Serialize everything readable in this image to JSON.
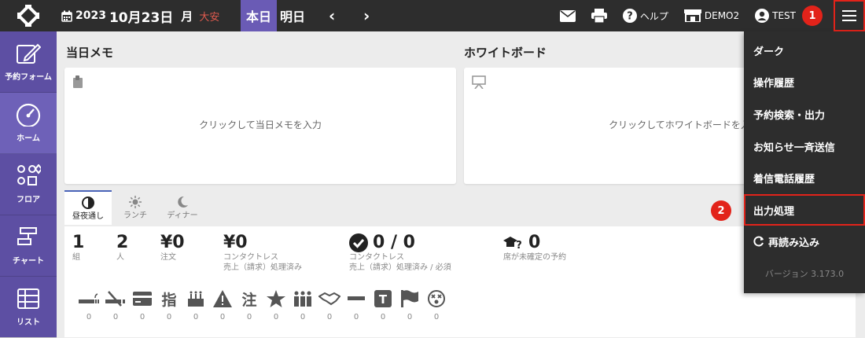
{
  "header": {
    "year": "2023",
    "month_day": "10月23日",
    "weekday": "月",
    "rokuyo": "大安",
    "today_label": "本日",
    "tomorrow_label": "明日",
    "help_label": "ヘルプ",
    "store_label": "DEMO2",
    "user_label": "TEST",
    "badge1": "1"
  },
  "sidebar": {
    "items": [
      {
        "label": "予約フォーム",
        "icon": "edit-icon"
      },
      {
        "label": "ホーム",
        "icon": "dashboard-icon"
      },
      {
        "label": "フロア",
        "icon": "floor-icon"
      },
      {
        "label": "チャート",
        "icon": "chart-icon"
      },
      {
        "label": "リスト",
        "icon": "list-icon"
      }
    ]
  },
  "memo": {
    "title": "当日メモ",
    "hint": "クリックして当日メモを入力"
  },
  "whiteboard": {
    "title": "ホワイトボード",
    "hint": "クリックしてホワイトボードを入力"
  },
  "tabs": [
    {
      "label": "昼夜通し",
      "icon": "half-circle-icon"
    },
    {
      "label": "ランチ",
      "icon": "sun-icon"
    },
    {
      "label": "ディナー",
      "icon": "moon-icon"
    }
  ],
  "stats": [
    {
      "num": "1",
      "lbl1": "組",
      "lbl2": ""
    },
    {
      "num": "2",
      "lbl1": "人",
      "lbl2": ""
    },
    {
      "num": "¥0",
      "lbl1": "注文",
      "lbl2": ""
    },
    {
      "num": "¥0",
      "lbl1": "コンタクトレス",
      "lbl2": "売上（請求）処理済み"
    },
    {
      "num": "0 / 0",
      "lbl1": "コンタクトレス",
      "lbl2": "売上（請求）処理済み / 必須"
    },
    {
      "num": "0",
      "lbl1": "席が未確定の予約",
      "lbl2": ""
    }
  ],
  "icon_counts": [
    "0",
    "0",
    "0",
    "0",
    "0",
    "0",
    "0",
    "0",
    "0",
    "0",
    "0",
    "0",
    "0",
    "0"
  ],
  "icon_glyphs": {
    "finger": "指",
    "note": "注",
    "flag_T": "T"
  },
  "menu": {
    "items": [
      "ダーク",
      "操作履歴",
      "予約検索・出力",
      "お知らせ一斉送信",
      "着信電話履歴",
      "出力処理",
      "再読み込み"
    ],
    "version": "バージョン 3.173.0",
    "badge2": "2"
  }
}
